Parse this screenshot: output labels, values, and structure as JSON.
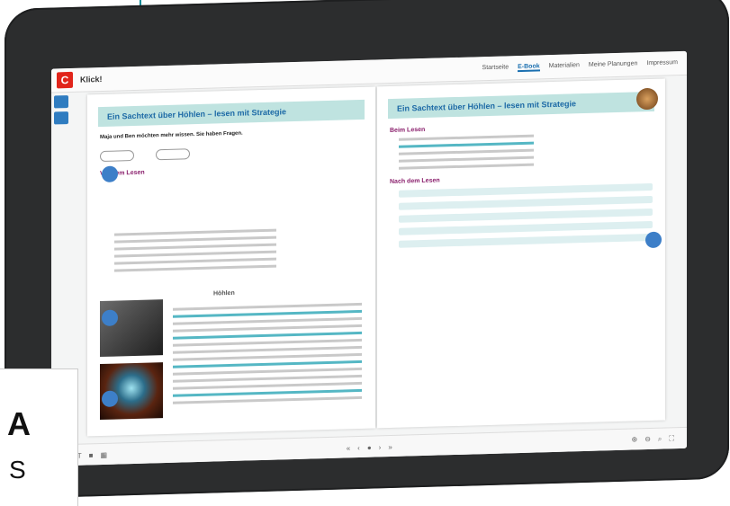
{
  "app": {
    "title": "Klick!",
    "logo_letter": "C"
  },
  "nav": {
    "items": [
      "Startseite",
      "E-Book",
      "Materialien",
      "Meine Planungen",
      "Impressum"
    ],
    "active": "E-Book"
  },
  "left_page": {
    "banner": "Ein Sachtext über Höhlen – lesen mit Strategie",
    "intro": "Maja und Ben möchten mehr wissen. Sie haben Fragen.",
    "section1": "Vor dem Lesen",
    "heading": "Höhlen"
  },
  "right_page": {
    "banner": "Ein Sachtext über Höhlen – lesen mit Strategie",
    "section1": "Beim Lesen",
    "section2": "Nach dem Lesen"
  },
  "overlay": {
    "letter_a": "A",
    "letter_s": "S"
  },
  "colors": {
    "accent": "#0b8d9a",
    "banner": "#bfe3e0",
    "brand": "#e1251b"
  }
}
